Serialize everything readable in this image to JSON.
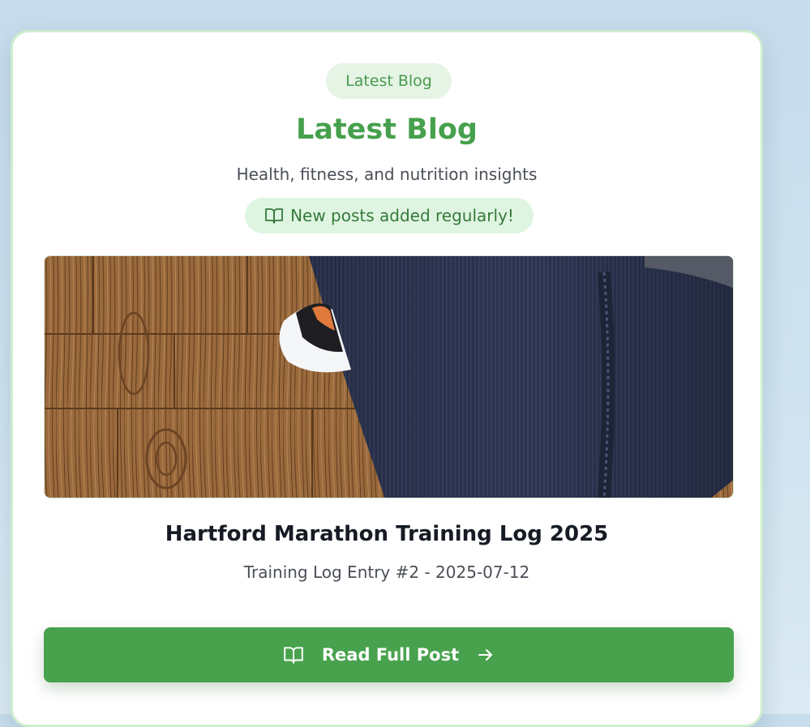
{
  "card": {
    "badge_label": "Latest Blog",
    "heading": "Latest Blog",
    "subtitle": "Health, fitness, and nutrition insights",
    "note": "New posts added regularly!"
  },
  "post": {
    "image_icon": "blog-photo",
    "title": "Hartford Marathon Training Log 2025",
    "meta": "Training Log Entry #2 - 2025-07-12"
  },
  "cta": {
    "label": "Read Full Post",
    "leading_icon": "book-open-icon",
    "trailing_icon": "arrow-right-icon"
  },
  "colors": {
    "accent": "#48a24d",
    "heading": "#46a04d",
    "badge_bg": "#e6f4e6",
    "note_bg": "#dff5e2",
    "card_border": "#cdeecd",
    "page_bg": "#c7ddec"
  }
}
